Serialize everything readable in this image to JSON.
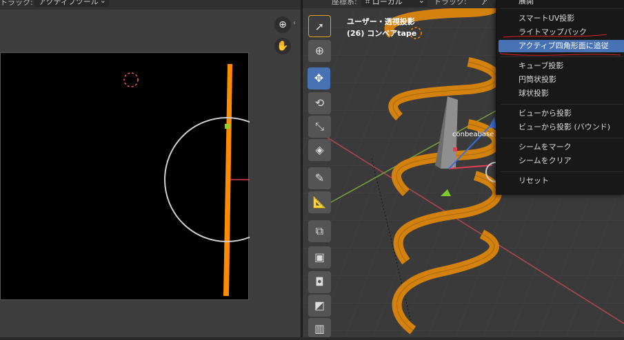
{
  "uv_editor": {
    "header_label": "トラック:",
    "dropdown_value": "アクティブツール",
    "zoom_icon": "zoom-icon",
    "pan_icon": "hand-icon"
  },
  "viewport": {
    "header_coord_label": "座標系:",
    "header_coord_value": "ローカル",
    "header_track_label": "トラック:",
    "header_track_value": "ア",
    "view_title": "ユーザー・透視投影",
    "object_label": "(26) コンベアtape",
    "mesh_label": "conbeabase"
  },
  "menu": {
    "header_partial": "展開",
    "items": [
      "スマートUV投影",
      "ライトマップパック",
      "アクティブ四角形面に追従",
      "キューブ投影",
      "円筒状投影",
      "球状投影",
      "ビューから投影",
      "ビューから投影 (バウンド)",
      "シームをマーク",
      "シームをクリア",
      "リセット"
    ],
    "highlighted_index": 2
  },
  "colors": {
    "accent": "#4772b3",
    "orange": "#ff8c00",
    "spiral": "#d4820f",
    "menu_bg": "#181818"
  }
}
